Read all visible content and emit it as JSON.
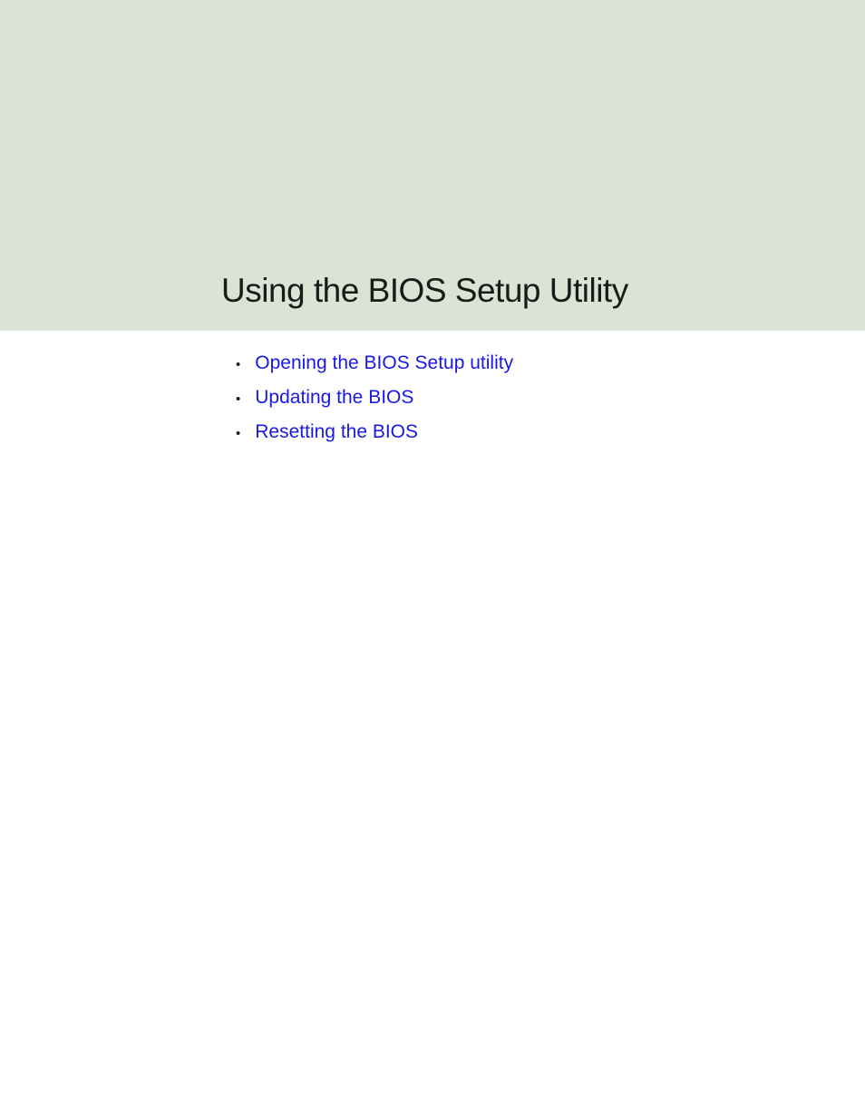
{
  "title": "Using the BIOS Setup Utility",
  "toc": {
    "items": [
      {
        "label": "Opening the BIOS Setup utility"
      },
      {
        "label": "Updating the BIOS"
      },
      {
        "label": "Resetting the BIOS"
      }
    ]
  }
}
